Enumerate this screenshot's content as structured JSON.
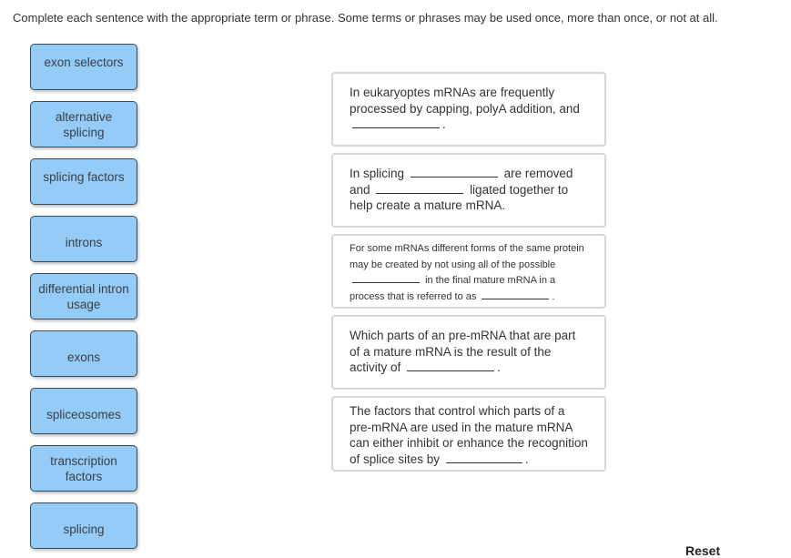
{
  "instructions": "Complete each sentence with the appropriate term or phrase.  Some terms or phrases may be used once, more than once, or not at all.",
  "terms": [
    "exon selectors",
    "alternative splicing",
    "splicing factors",
    "introns",
    "differential intron usage",
    "exons",
    "spliceosomes",
    "transcription factors",
    "splicing"
  ],
  "sentences": [
    {
      "parts": [
        "In eukaryoptes mRNAs are frequently processed by capping, polyA addition, and",
        "."
      ]
    },
    {
      "parts": [
        "In splicing",
        "are removed and",
        "ligated together to help create a mature mRNA."
      ]
    },
    {
      "parts": [
        "For some mRNAs different forms of the same protein may be created by not using all of the possible",
        "in the final mature mRNA in a process that is referred to as",
        "."
      ]
    },
    {
      "parts": [
        "Which parts of an pre-mRNA that are part of a mature mRNA is the result of the activity of",
        "."
      ]
    },
    {
      "parts": [
        "The factors that control which parts of a pre-mRNA are used in the mature mRNA can either inhibit or enhance the recognition of splice sites by",
        "."
      ]
    }
  ],
  "reset_label": "Reset",
  "colors": {
    "tile_fill": "#94ccf7",
    "tile_border": "#3b4a57",
    "card_border": "#d6d6d6"
  }
}
